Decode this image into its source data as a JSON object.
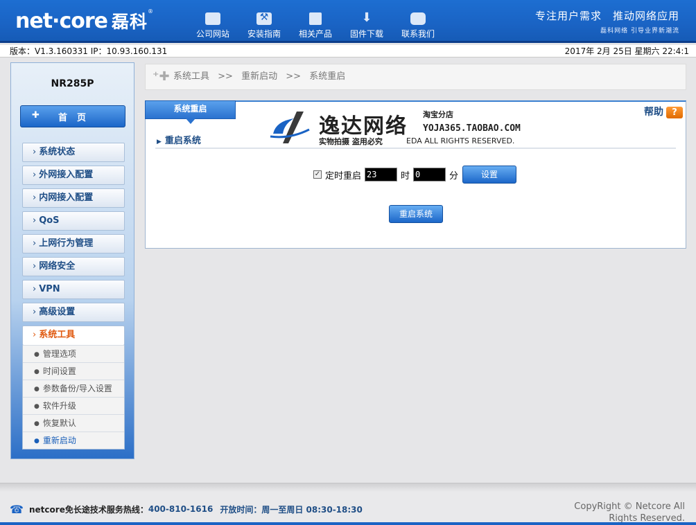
{
  "header": {
    "logo_text": "net·core",
    "logo_cn": "磊科",
    "nav": [
      {
        "label": "公司网站",
        "icon": "company-site-icon"
      },
      {
        "label": "安装指南",
        "icon": "install-guide-icon"
      },
      {
        "label": "相关产品",
        "icon": "products-icon"
      },
      {
        "label": "固件下载",
        "icon": "download-icon"
      },
      {
        "label": "联系我们",
        "icon": "contact-icon"
      }
    ],
    "slogan": "专注用户需求　推动网络应用",
    "slogan_sub": "磊科网络 引导业界新潮流"
  },
  "infobar": {
    "version": "版本：V1.3.160331  IP：10.93.160.131",
    "datetime": "2017年 2月 25日 星期六 22:4:1"
  },
  "sidebar": {
    "model": "NR285P",
    "home": "首页",
    "items": [
      {
        "label": "系统状态"
      },
      {
        "label": "外网接入配置"
      },
      {
        "label": "内网接入配置"
      },
      {
        "label": "QoS"
      },
      {
        "label": "上网行为管理"
      },
      {
        "label": "网络安全"
      },
      {
        "label": "VPN"
      },
      {
        "label": "高级设置"
      }
    ],
    "active_item": "系统工具",
    "subitems": [
      {
        "label": "管理选项"
      },
      {
        "label": "时间设置"
      },
      {
        "label": "参数备份/导入设置"
      },
      {
        "label": "软件升级"
      },
      {
        "label": "恢复默认"
      },
      {
        "label": "重新启动"
      }
    ]
  },
  "breadcrumb": {
    "level1": "系统工具",
    "level2": "重新启动",
    "level3": "系统重启",
    "sep": ">>"
  },
  "panel": {
    "tab": "系统重启",
    "help": "帮助",
    "help_icon": "?",
    "section": "重启系统",
    "schedule_label": "定时重启",
    "hour_value": "23",
    "hour_unit": "时",
    "minute_value": "0",
    "minute_unit": "分",
    "set_button": "设置",
    "reboot_button": "重启系统",
    "checkbox_checked": true
  },
  "watermark": {
    "title": "逸达网络",
    "branch": "淘宝分店",
    "site": "YOJA365.TAOBAO.COM",
    "tag": "实物拍摄 盗用必究",
    "rights": "EDA  ALL RIGHTS RESERVED."
  },
  "footer": {
    "hotline_prefix": "netcore免长途技术服务热线：",
    "hotline_number": "400-810-1616",
    "hours": "开放时间：周一至周日 08:30-18:30",
    "copyright": "CopyRight © Netcore All Rights Reserved."
  },
  "colors": {
    "header_blue": "#1a63c4",
    "accent_orange": "#e05a10",
    "link_blue": "#1f4e86"
  }
}
